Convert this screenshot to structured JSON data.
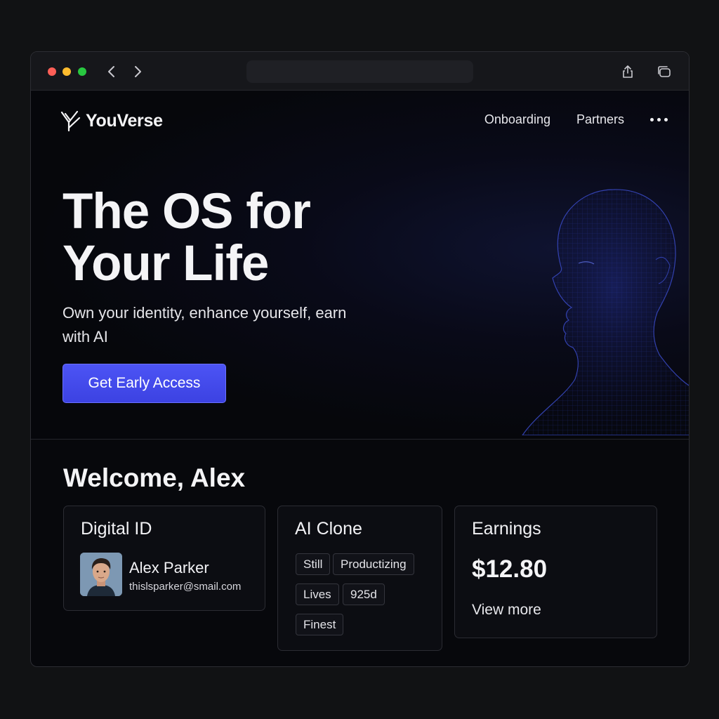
{
  "brand": {
    "name": "YouVerse",
    "accent": "#4b52f2"
  },
  "nav": {
    "items": [
      "Onboarding",
      "Partners"
    ],
    "more_icon": "more-horizontal-icon"
  },
  "hero": {
    "headline": "The OS for Your Life",
    "subline": "Own your identity, enhance yourself, earn with AI",
    "cta_label": "Get Early Access"
  },
  "dashboard": {
    "welcome": "Welcome, Alex",
    "digital_id": {
      "title": "Digital ID",
      "name": "Alex Parker",
      "email": "thislsparker@smail.com"
    },
    "ai_clone": {
      "title": "AI Clone",
      "tags": [
        "Still",
        "Productizing",
        "Lives",
        "925d",
        "Finest"
      ]
    },
    "earnings": {
      "title": "Earnings",
      "amount": "$12.80",
      "link_label": "View more"
    }
  }
}
